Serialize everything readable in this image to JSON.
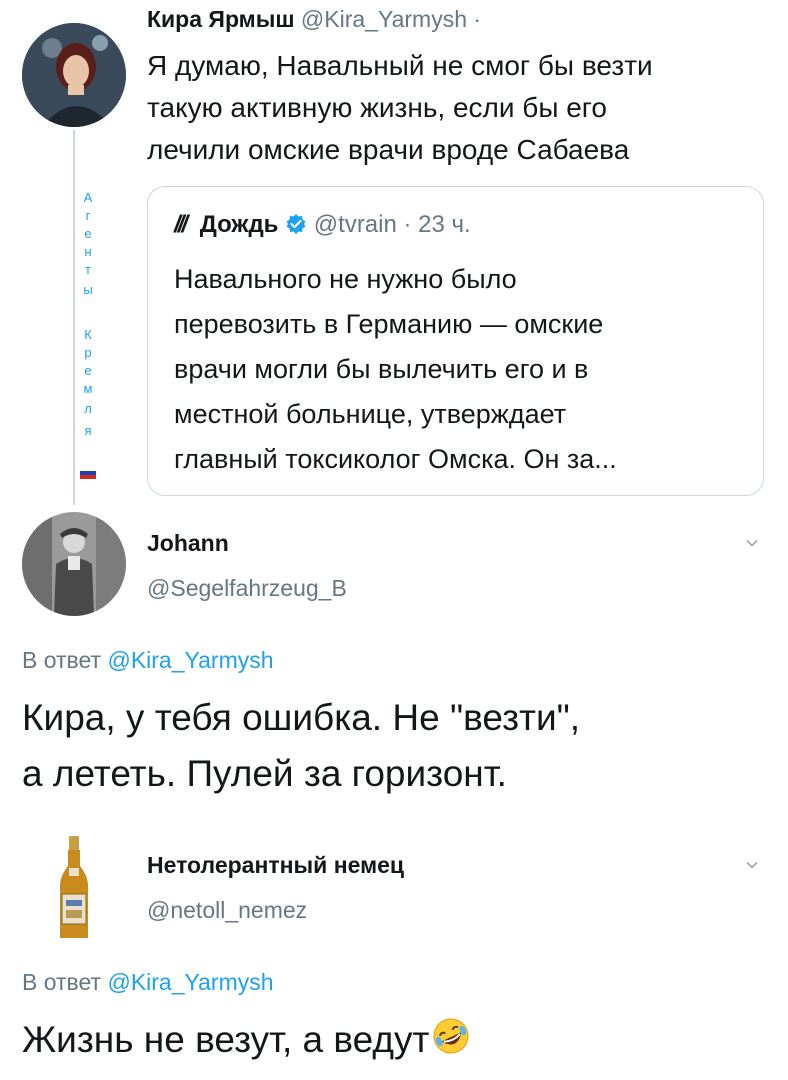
{
  "tweet1": {
    "author_name": "Кира Ярмыш",
    "author_handle": "@Kira_Yarmysh",
    "separator": "·",
    "lines": [
      "Я думаю, Навальный не смог бы везти",
      "такую активную жизнь, если бы его",
      "лечили омские врачи вроде Сабаева"
    ],
    "vertical_label": [
      "А",
      "г",
      "е",
      "н",
      "т",
      "ы",
      "",
      "К",
      "р",
      "е",
      "м",
      "л",
      "я"
    ]
  },
  "quote": {
    "brand_mark": "///",
    "author_name": "Дождь",
    "author_handle": "@tvrain",
    "time": "· 23 ч.",
    "lines": [
      "Навального не нужно было",
      "перевозить в Германию — омские",
      "врачи могли бы вылечить его и в",
      "местной больнице, утверждает",
      "главный токсиколог Омска. Он за..."
    ]
  },
  "reply1": {
    "author_name": "Johann",
    "author_handle": "@Segelfahrzeug_B",
    "reply_prefix": "В ответ",
    "reply_to": "@Kira_Yarmysh",
    "lines": [
      "Кира, у тебя ошибка. Не \"везти\",",
      "а лететь. Пулей за горизонт."
    ]
  },
  "reply2": {
    "author_name": "Нетолерантный немец",
    "author_handle": "@netoll_nemez",
    "reply_prefix": "В ответ",
    "reply_to": "@Kira_Yarmysh",
    "text": "Жизнь не везут, а ведут"
  },
  "colors": {
    "text": "#14171a",
    "secondary": "#657786",
    "link": "#1da1f2",
    "verified": "#1da1f2",
    "border": "#ccd6dd"
  },
  "icons": [
    "verified-badge-icon",
    "chevron-down-icon",
    "rolling-laughing-emoji",
    "russian-flag-icon"
  ]
}
